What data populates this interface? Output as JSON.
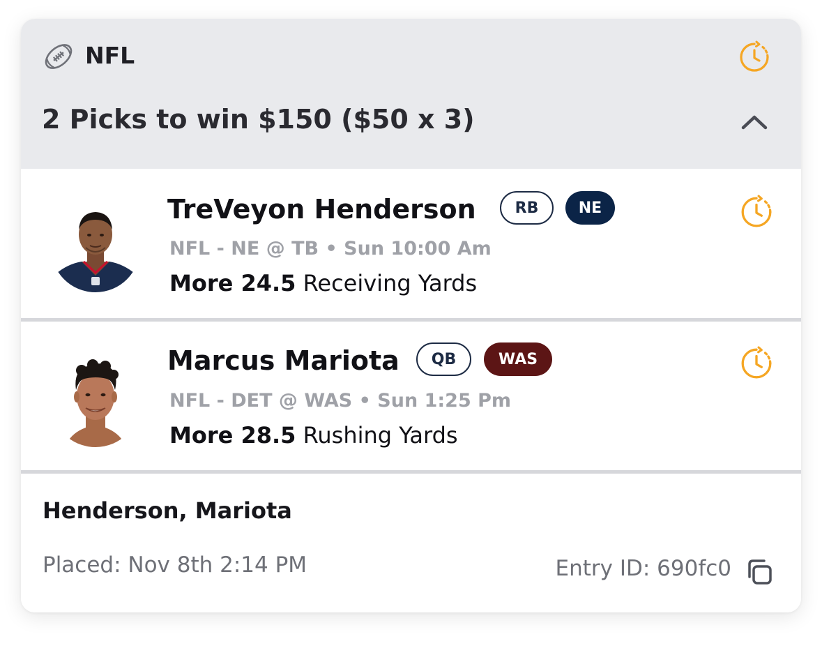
{
  "header": {
    "league_icon": "football-icon",
    "league": "NFL",
    "status_icon": "pending-clock-icon",
    "picks_title": "2 Picks to win $150 ($50 x 3)",
    "collapse_icon": "chevron-up-icon"
  },
  "picks": [
    {
      "player": "TreVeyon Henderson",
      "position": "RB",
      "team": "NE",
      "team_color": "#0b2447",
      "matchup": "NFL - NE @ TB • Sun 10:00 Am",
      "direction_value": "More 24.5",
      "stat": "Receiving Yards",
      "status_icon": "pending-clock-icon"
    },
    {
      "player": "Marcus Mariota",
      "position": "QB",
      "team": "WAS",
      "team_color": "#5c1515",
      "matchup": "NFL - DET @ WAS • Sun 1:25 Pm",
      "direction_value": "More 28.5",
      "stat": "Rushing Yards",
      "status_icon": "pending-clock-icon"
    }
  ],
  "footer": {
    "players_summary": "Henderson, Mariota",
    "placed": "Placed: Nov 8th 2:14 PM",
    "entry_id": "Entry ID: 690fc0",
    "copy_icon": "copy-icon"
  },
  "colors": {
    "accent_pending": "#f5a623",
    "header_bg": "#e9eaed",
    "badge_border": "#1d2b44"
  }
}
